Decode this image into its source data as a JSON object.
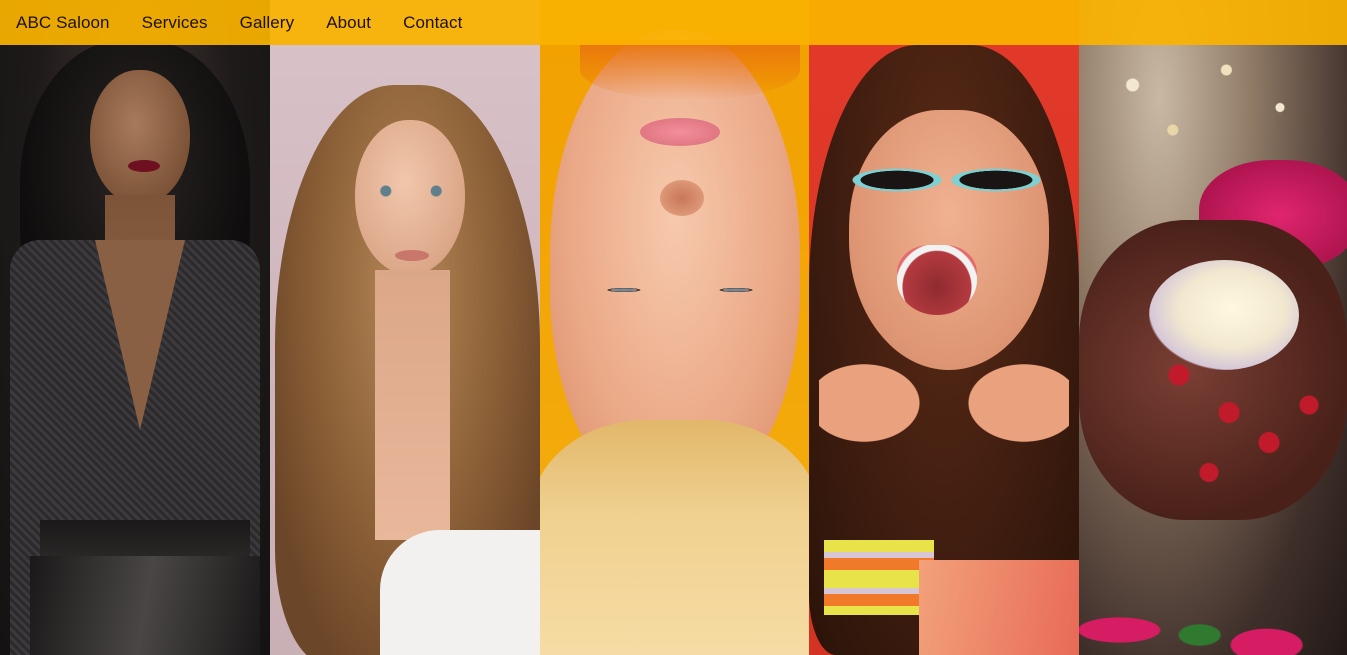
{
  "nav": {
    "brand": "ABC Saloon",
    "links": [
      "Services",
      "Gallery",
      "About",
      "Contact"
    ],
    "background": "#FAB300"
  },
  "gallery": {
    "panels": [
      {
        "subject": "woman in black sequined dress with dark wavy hair"
      },
      {
        "subject": "woman with long wavy blonde-brown hair"
      },
      {
        "subject": "upside-down face of blonde woman on yellow background"
      },
      {
        "subject": "excited woman in turquoise sunglasses with bracelets"
      },
      {
        "subject": "bride hands with henna and red nails holding flowers"
      }
    ]
  }
}
